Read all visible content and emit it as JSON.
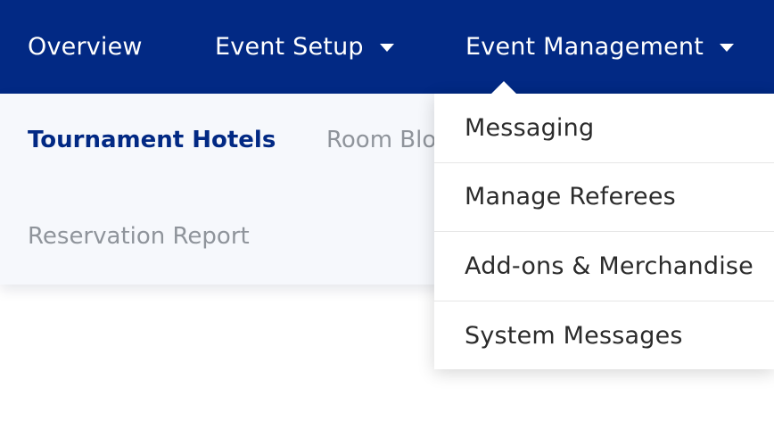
{
  "colors": {
    "nav_background": "#022984",
    "nav_text": "#ffffff",
    "active_subnav": "#022984",
    "inactive_subnav": "#8f949b"
  },
  "topnav": {
    "overview": "Overview",
    "event_setup": "Event Setup",
    "event_management": "Event Management"
  },
  "subnav": {
    "tournament_hotels": "Tournament Hotels",
    "room_blocks": "Room Blocks",
    "reservation_report": "Reservation Report"
  },
  "dropdown": {
    "items": [
      {
        "label": "Messaging"
      },
      {
        "label": "Manage Referees"
      },
      {
        "label": "Add-ons & Merchandise"
      },
      {
        "label": "System Messages"
      }
    ]
  },
  "icons": {
    "dropdown_caret": "chevron-down-icon"
  }
}
